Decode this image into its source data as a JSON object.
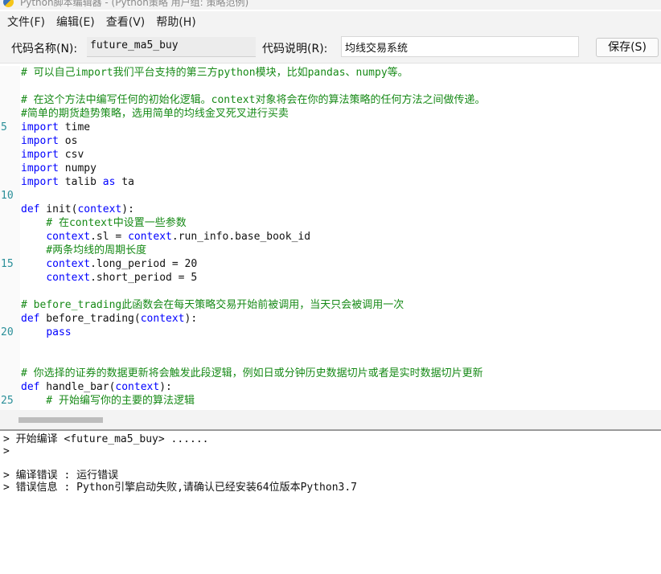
{
  "window": {
    "title": "Python脚本编辑器 - (Python策略 用户组: 策略范例)"
  },
  "menu": {
    "items": [
      "文件(F)",
      "编辑(E)",
      "查看(V)",
      "帮助(H)"
    ]
  },
  "toolbar": {
    "code_name_label": "代码名称(N):",
    "code_name_value": "future_ma5_buy",
    "code_desc_label": "代码说明(R):",
    "code_desc_value": "均线交易系统",
    "save_label": "保存(S)"
  },
  "editor": {
    "line_numbers": [
      "",
      "",
      "",
      "",
      "5",
      "",
      "",
      "",
      "",
      "10",
      "",
      "",
      "",
      "",
      "15",
      "",
      "",
      "",
      "",
      "20",
      "",
      "",
      "",
      "",
      "25"
    ],
    "lines": [
      [
        {
          "t": "# 可以自己import我们平台支持的第三方python模块，比如pandas、numpy等。",
          "c": "comment"
        }
      ],
      [
        {
          "t": "",
          "c": "plain"
        }
      ],
      [
        {
          "t": "# 在这个方法中编写任何的初始化逻辑。context对象将会在你的算法策略的任何方法之间做传递。",
          "c": "comment"
        }
      ],
      [
        {
          "t": "#简单的期货趋势策略，选用简单的均线金叉死叉进行买卖",
          "c": "comment"
        }
      ],
      [
        {
          "t": "import",
          "c": "kw"
        },
        {
          "t": " time",
          "c": "plain"
        }
      ],
      [
        {
          "t": "import",
          "c": "kw"
        },
        {
          "t": " os",
          "c": "plain"
        }
      ],
      [
        {
          "t": "import",
          "c": "kw"
        },
        {
          "t": " csv",
          "c": "plain"
        }
      ],
      [
        {
          "t": "import",
          "c": "kw"
        },
        {
          "t": " numpy",
          "c": "plain"
        }
      ],
      [
        {
          "t": "import",
          "c": "kw"
        },
        {
          "t": " talib ",
          "c": "plain"
        },
        {
          "t": "as",
          "c": "kw"
        },
        {
          "t": " ta",
          "c": "plain"
        }
      ],
      [
        {
          "t": "",
          "c": "plain"
        }
      ],
      [
        {
          "t": "def",
          "c": "kw"
        },
        {
          "t": " init(",
          "c": "plain"
        },
        {
          "t": "context",
          "c": "ctx"
        },
        {
          "t": "):",
          "c": "plain"
        }
      ],
      [
        {
          "t": "    # 在context中设置一些参数",
          "c": "comment"
        }
      ],
      [
        {
          "t": "    ",
          "c": "plain"
        },
        {
          "t": "context",
          "c": "ctx"
        },
        {
          "t": ".sl = ",
          "c": "plain"
        },
        {
          "t": "context",
          "c": "ctx"
        },
        {
          "t": ".run_info.base_book_id",
          "c": "plain"
        }
      ],
      [
        {
          "t": "    #两条均线的周期长度",
          "c": "comment"
        }
      ],
      [
        {
          "t": "    ",
          "c": "plain"
        },
        {
          "t": "context",
          "c": "ctx"
        },
        {
          "t": ".long_period = 20",
          "c": "plain"
        }
      ],
      [
        {
          "t": "    ",
          "c": "plain"
        },
        {
          "t": "context",
          "c": "ctx"
        },
        {
          "t": ".short_period = 5",
          "c": "plain"
        }
      ],
      [
        {
          "t": "",
          "c": "plain"
        }
      ],
      [
        {
          "t": "# before_trading此函数会在每天策略交易开始前被调用，当天只会被调用一次",
          "c": "comment"
        }
      ],
      [
        {
          "t": "def",
          "c": "kw"
        },
        {
          "t": " before_trading(",
          "c": "plain"
        },
        {
          "t": "context",
          "c": "ctx"
        },
        {
          "t": "):",
          "c": "plain"
        }
      ],
      [
        {
          "t": "    ",
          "c": "plain"
        },
        {
          "t": "pass",
          "c": "kw"
        }
      ],
      [
        {
          "t": "",
          "c": "plain"
        }
      ],
      [
        {
          "t": "",
          "c": "plain"
        }
      ],
      [
        {
          "t": "# 你选择的证券的数据更新将会触发此段逻辑，例如日或分钟历史数据切片或者是实时数据切片更新",
          "c": "comment"
        }
      ],
      [
        {
          "t": "def",
          "c": "kw"
        },
        {
          "t": " handle_bar(",
          "c": "plain"
        },
        {
          "t": "context",
          "c": "ctx"
        },
        {
          "t": "):",
          "c": "plain"
        }
      ],
      [
        {
          "t": "    # 开始编写你的主要的算法逻辑",
          "c": "comment"
        }
      ]
    ]
  },
  "console": {
    "lines": [
      "> 开始编译 <future_ma5_buy> ......",
      ">",
      "",
      "> 编译错误 : 运行错误",
      "> 错误信息 : Python引擎启动失败,请确认已经安装64位版本Python3.7"
    ]
  }
}
